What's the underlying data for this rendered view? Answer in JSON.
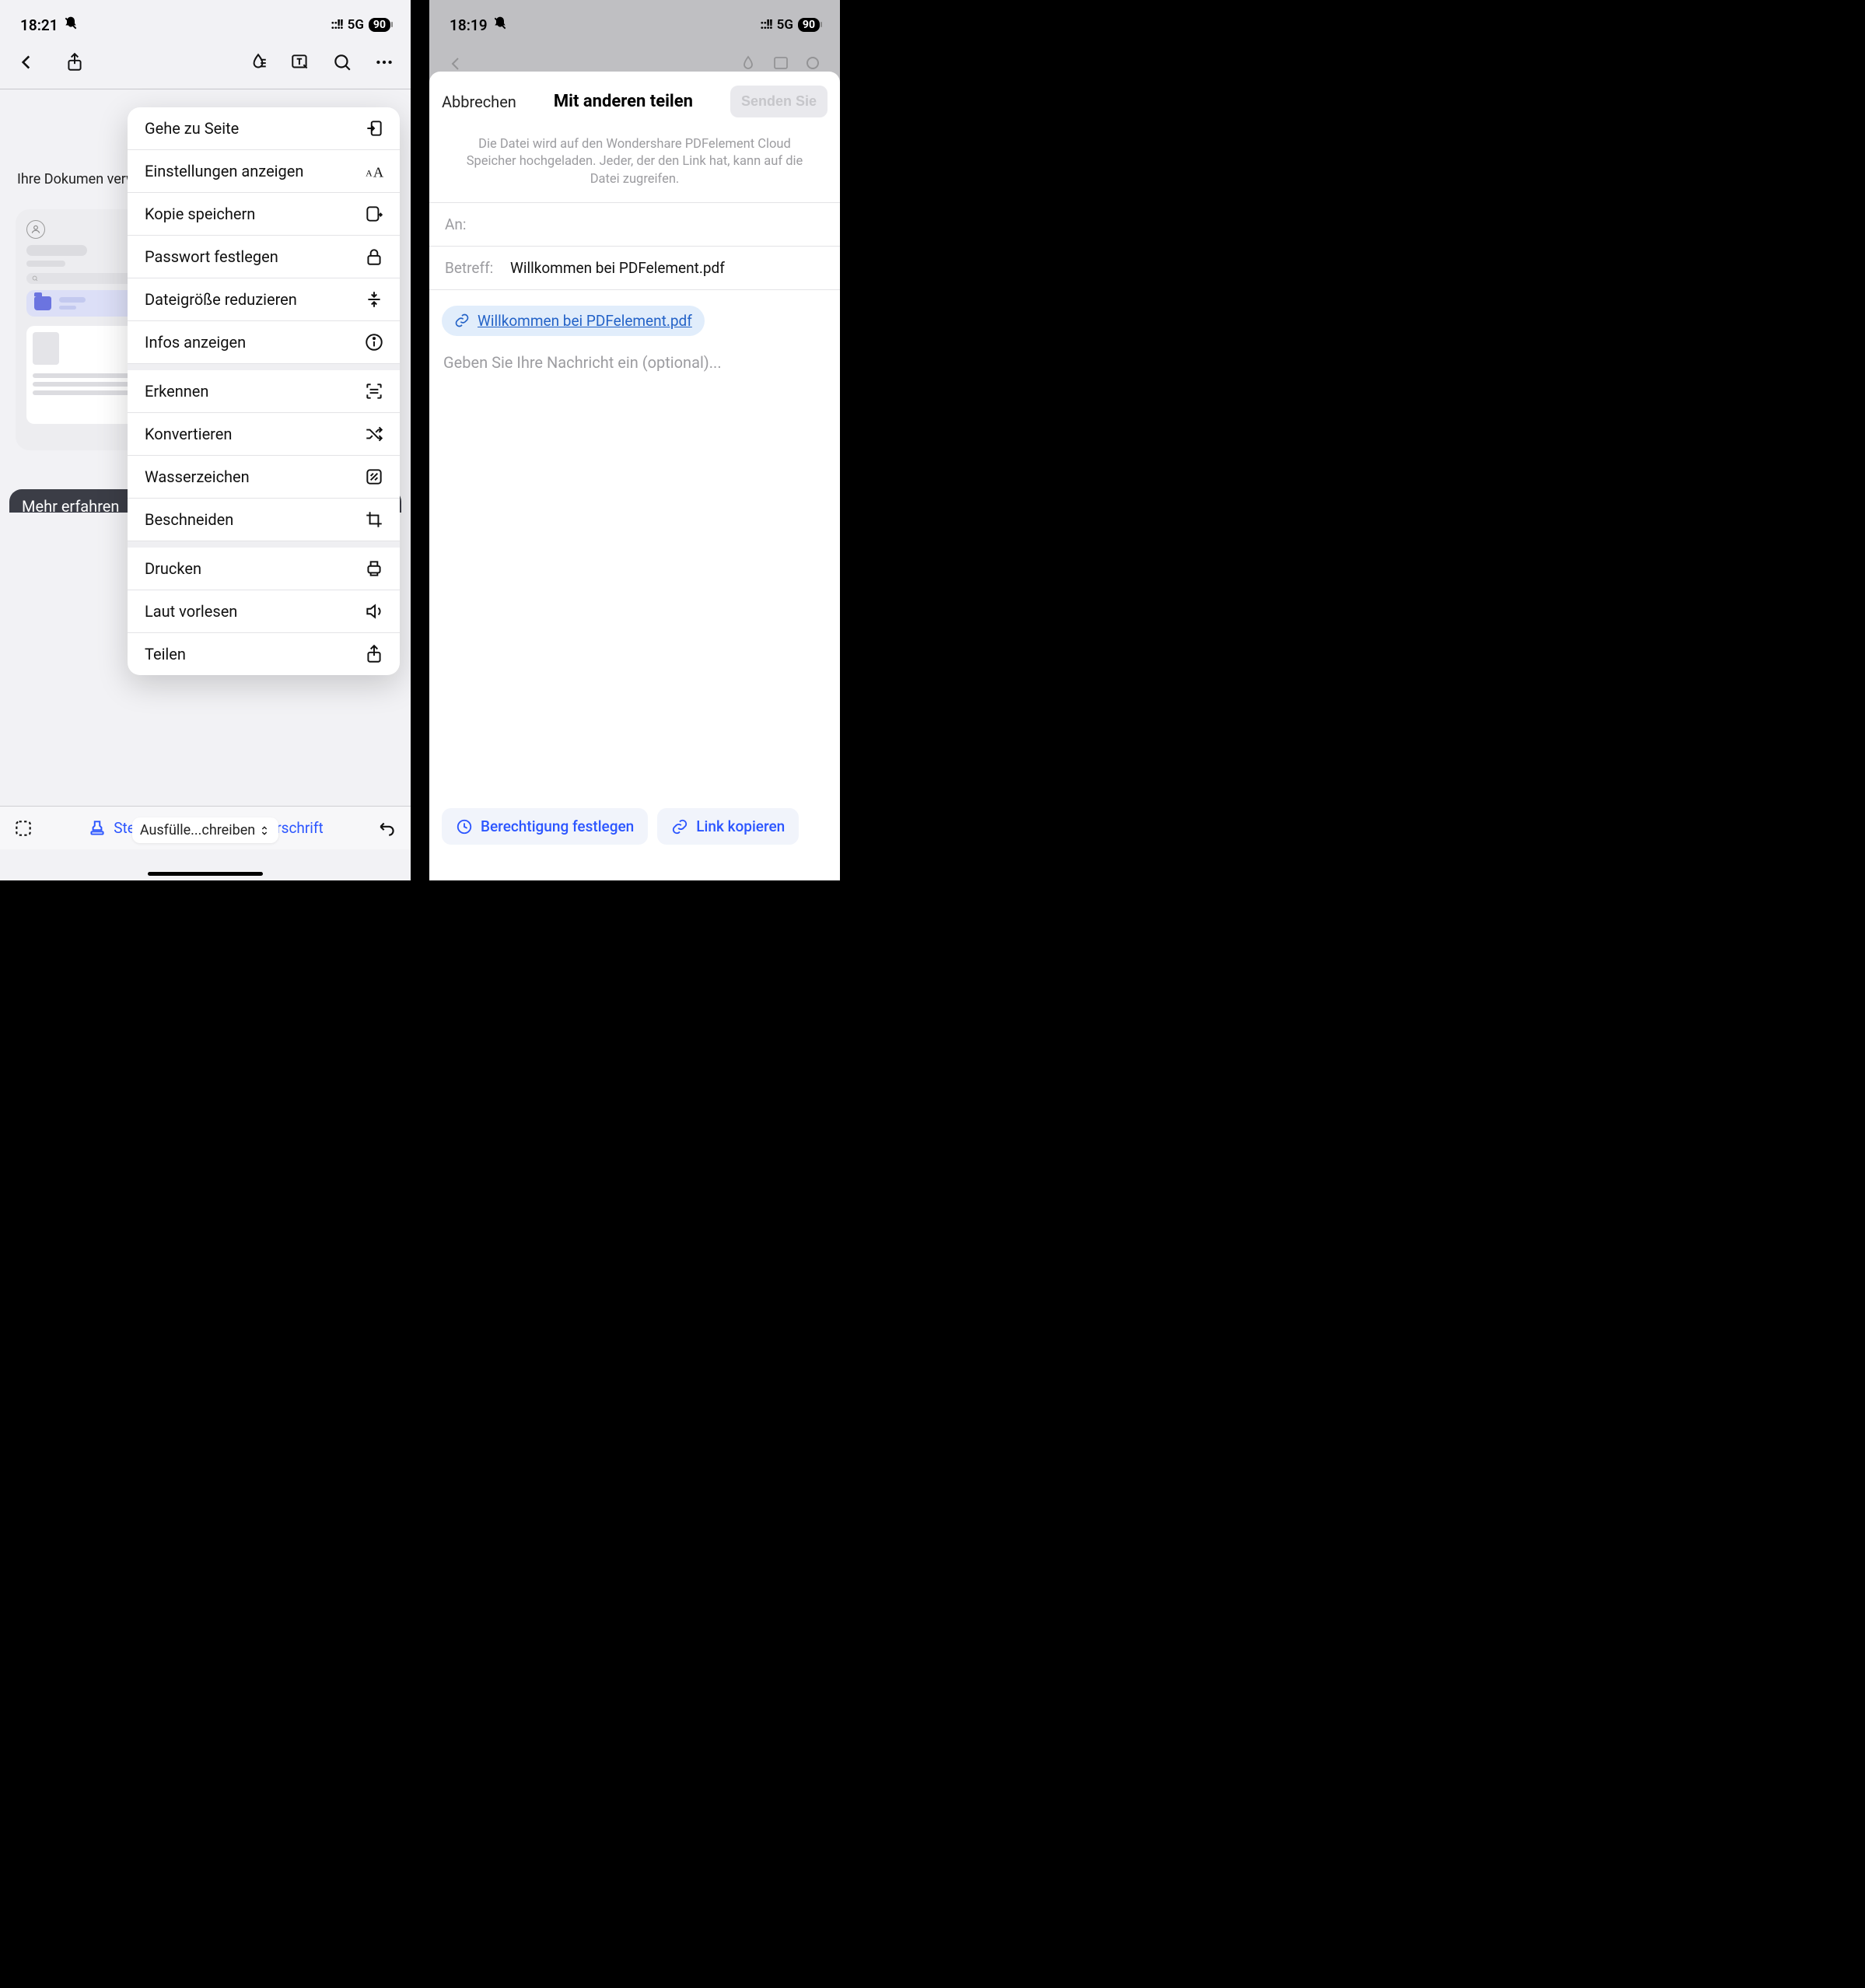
{
  "left": {
    "status": {
      "time": "18:21",
      "network": "5G",
      "battery": "90"
    },
    "doc_text": "Ihre Dokumen verwalten.",
    "mehr": "Mehr erfahren",
    "toolbar": {
      "stempel": "Stempel",
      "unterschrift": "Unterschrift"
    },
    "mode_pill": "Ausfülle...chreiben",
    "menu": {
      "group1": [
        {
          "label": "Gehe zu Seite",
          "icon": "goto"
        },
        {
          "label": "Einstellungen anzeigen",
          "icon": "textsize"
        },
        {
          "label": "Kopie speichern",
          "icon": "savecopy"
        },
        {
          "label": "Passwort festlegen",
          "icon": "lock"
        },
        {
          "label": "Dateigröße reduzieren",
          "icon": "compress"
        },
        {
          "label": "Infos anzeigen",
          "icon": "info"
        }
      ],
      "group2": [
        {
          "label": "Erkennen",
          "icon": "scan"
        },
        {
          "label": "Konvertieren",
          "icon": "shuffle"
        },
        {
          "label": "Wasserzeichen",
          "icon": "watermark"
        },
        {
          "label": "Beschneiden",
          "icon": "crop"
        }
      ],
      "group3": [
        {
          "label": "Drucken",
          "icon": "print"
        },
        {
          "label": "Laut vorlesen",
          "icon": "speaker"
        },
        {
          "label": "Teilen",
          "icon": "share"
        }
      ]
    }
  },
  "right": {
    "status": {
      "time": "18:19",
      "network": "5G",
      "battery": "90"
    },
    "sheet": {
      "cancel": "Abbrechen",
      "title": "Mit anderen teilen",
      "send": "Senden Sie",
      "info": "Die Datei wird auf den Wondershare PDFelement Cloud Speicher hochgeladen. Jeder, der den Link hat, kann auf die Datei zugreifen.",
      "to_label": "An:",
      "subject_label": "Betreff:",
      "subject_value": "Willkommen bei PDFelement.pdf",
      "link_name": "Willkommen bei PDFelement.pdf",
      "msg_placeholder": "Geben Sie Ihre Nachricht ein (optional)...",
      "perm": "Berechtigung festlegen",
      "copy": "Link kopieren"
    }
  }
}
